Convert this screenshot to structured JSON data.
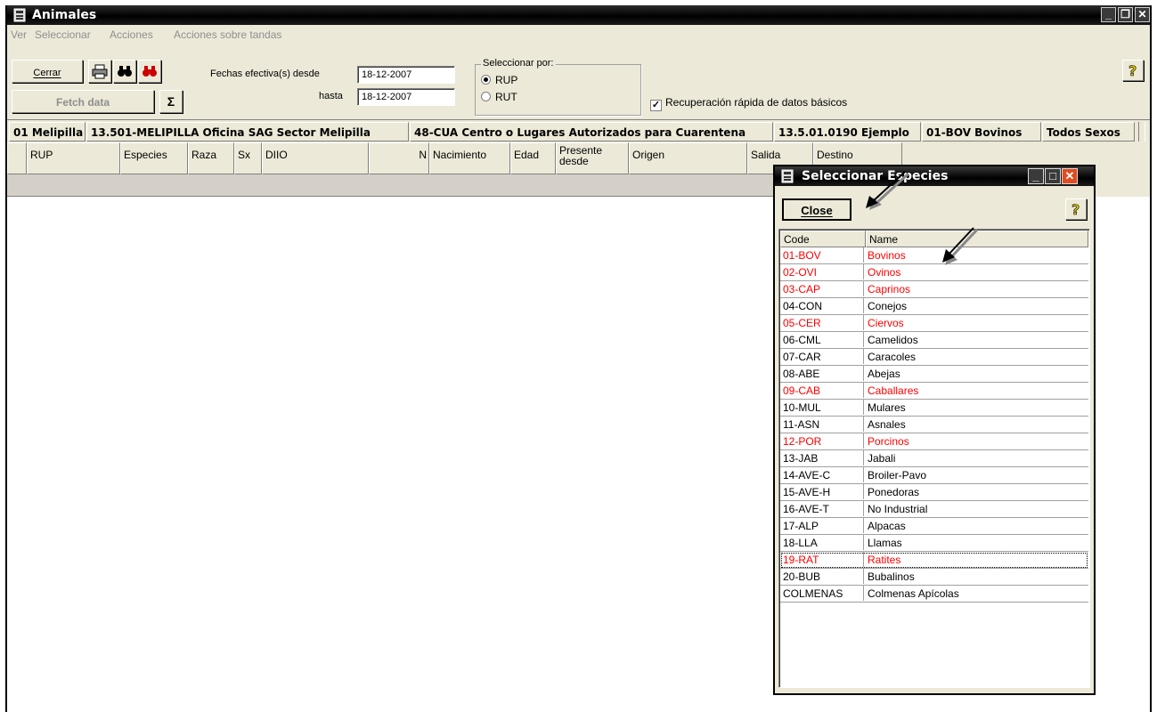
{
  "window": {
    "title": "Animales"
  },
  "menu": [
    "Ver",
    "Seleccionar",
    "Acciones",
    "Acciones sobre tandas"
  ],
  "toolbar": {
    "cerrar_label": "Cerrar",
    "fetch_label": "Fetch data",
    "sum_label": "Σ",
    "fechas_label": "Fechas efectiva(s) desde",
    "desde_value": "18-12-2007",
    "hasta_label": "hasta",
    "hasta_value": "18-12-2007",
    "group_label": "Seleccionar por:",
    "radio_rup": "RUP",
    "radio_rut": "RUT",
    "check_label": "Recuperación rápida de datos básicos"
  },
  "info": [
    "01 Melipilla",
    "13.501-MELIPILLA Oficina SAG Sector Melipilla",
    "48-CUA Centro o Lugares Autorizados para Cuarentena",
    "13.5.01.0190 Ejemplo",
    "01-BOV Bovinos",
    "Todos Sexos"
  ],
  "grid_columns": [
    "RUP",
    "Especies",
    "Raza",
    "Sx",
    "DIIO",
    "N",
    "Nacimiento",
    "Edad",
    "Presente desde",
    "Origen",
    "Salida",
    "Destino"
  ],
  "popup": {
    "title": "Seleccionar Especies",
    "close_label": "Close",
    "col_code": "Code",
    "col_name": "Name",
    "rows": [
      {
        "code": "01-BOV",
        "name": "Bovinos",
        "red": true
      },
      {
        "code": "02-OVI",
        "name": "Ovinos",
        "red": true
      },
      {
        "code": "03-CAP",
        "name": "Caprinos",
        "red": true
      },
      {
        "code": "04-CON",
        "name": "Conejos",
        "red": false
      },
      {
        "code": "05-CER",
        "name": "Ciervos",
        "red": true
      },
      {
        "code": "06-CML",
        "name": "Camelidos",
        "red": false
      },
      {
        "code": "07-CAR",
        "name": "Caracoles",
        "red": false
      },
      {
        "code": "08-ABE",
        "name": "Abejas",
        "red": false
      },
      {
        "code": "09-CAB",
        "name": "Caballares",
        "red": true
      },
      {
        "code": "10-MUL",
        "name": "Mulares",
        "red": false
      },
      {
        "code": "11-ASN",
        "name": "Asnales",
        "red": false
      },
      {
        "code": "12-POR",
        "name": "Porcinos",
        "red": true
      },
      {
        "code": "13-JAB",
        "name": "Jabali",
        "red": false
      },
      {
        "code": "14-AVE-C",
        "name": "Broiler-Pavo",
        "red": false
      },
      {
        "code": "15-AVE-H",
        "name": "Ponedoras",
        "red": false
      },
      {
        "code": "16-AVE-T",
        "name": "No Industrial",
        "red": false
      },
      {
        "code": "17-ALP",
        "name": "Alpacas",
        "red": false
      },
      {
        "code": "18-LLA",
        "name": "Llamas",
        "red": false
      },
      {
        "code": "19-RAT",
        "name": "Ratites",
        "red": true,
        "selected": true
      },
      {
        "code": "20-BUB",
        "name": "Bubalinos",
        "red": false
      },
      {
        "code": "COLMENAS",
        "name": "Colmenas Apícolas",
        "red": false
      }
    ]
  },
  "colors": {
    "title_bg": "#000000",
    "dialog_bg": "#ECE9D8",
    "highlight_text": "#ff0000"
  }
}
